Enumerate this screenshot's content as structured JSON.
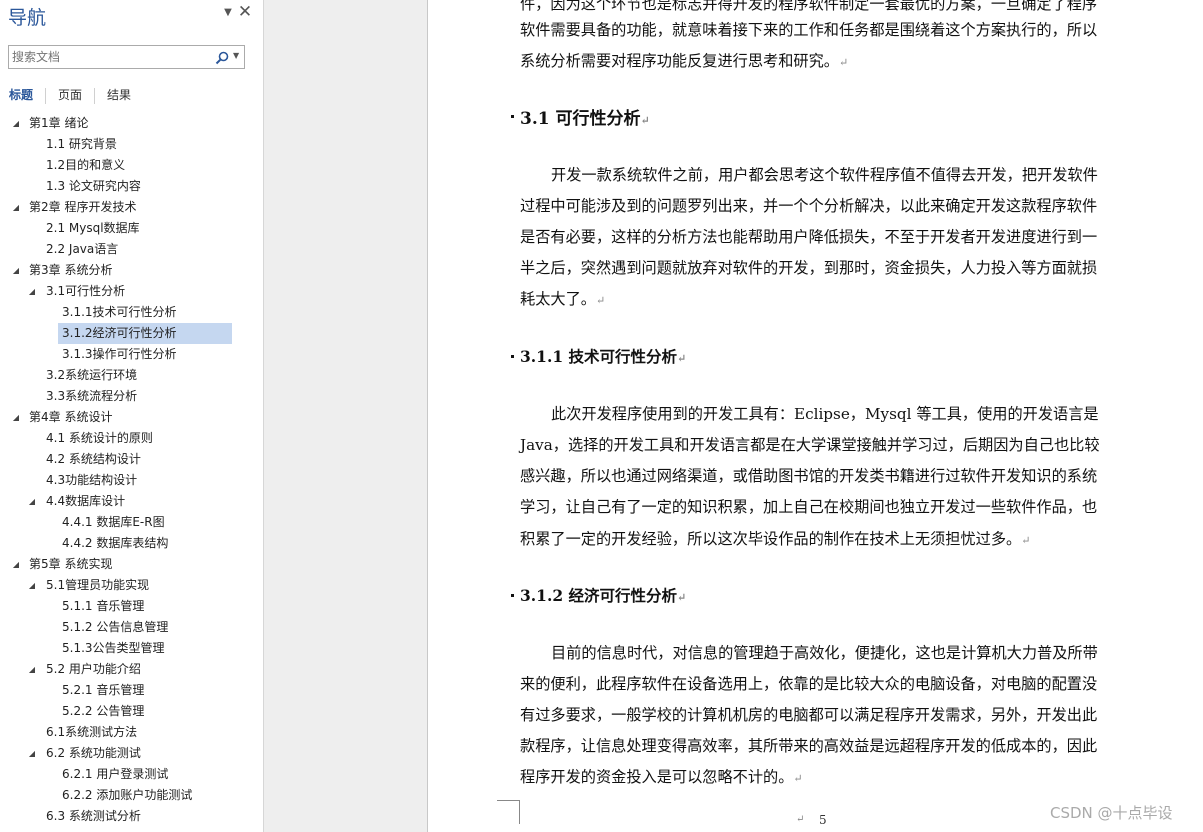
{
  "nav": {
    "title": "导航",
    "search_placeholder": "搜索文档",
    "tabs": [
      {
        "label": "标题",
        "active": true
      },
      {
        "label": "页面",
        "active": false
      },
      {
        "label": "结果",
        "active": false
      }
    ],
    "tree": [
      {
        "label": "第1章 绪论",
        "level": 0,
        "expanded": true
      },
      {
        "label": "1.1 研究背景",
        "level": 1
      },
      {
        "label": "1.2目的和意义",
        "level": 1
      },
      {
        "label": "1.3 论文研究内容",
        "level": 1
      },
      {
        "label": "第2章 程序开发技术",
        "level": 0,
        "expanded": true
      },
      {
        "label": "2.1 Mysql数据库",
        "level": 1
      },
      {
        "label": "2.2 Java语言",
        "level": 1
      },
      {
        "label": "第3章 系统分析",
        "level": 0,
        "expanded": true
      },
      {
        "label": "3.1可行性分析",
        "level": 1,
        "expanded": true
      },
      {
        "label": "3.1.1技术可行性分析",
        "level": 2
      },
      {
        "label": "3.1.2经济可行性分析",
        "level": 2,
        "selected": true
      },
      {
        "label": "3.1.3操作可行性分析",
        "level": 2
      },
      {
        "label": "3.2系统运行环境",
        "level": 1
      },
      {
        "label": "3.3系统流程分析",
        "level": 1
      },
      {
        "label": "第4章 系统设计",
        "level": 0,
        "expanded": true
      },
      {
        "label": "4.1 系统设计的原则",
        "level": 1
      },
      {
        "label": "4.2 系统结构设计",
        "level": 1
      },
      {
        "label": "4.3功能结构设计",
        "level": 1
      },
      {
        "label": "4.4数据库设计",
        "level": 1,
        "expanded": true
      },
      {
        "label": "4.4.1 数据库E-R图",
        "level": 2
      },
      {
        "label": "4.4.2 数据库表结构",
        "level": 2
      },
      {
        "label": "第5章 系统实现",
        "level": 0,
        "expanded": true
      },
      {
        "label": "5.1管理员功能实现",
        "level": 1,
        "expanded": true
      },
      {
        "label": "5.1.1 音乐管理",
        "level": 2
      },
      {
        "label": "5.1.2 公告信息管理",
        "level": 2
      },
      {
        "label": "5.1.3公告类型管理",
        "level": 2
      },
      {
        "label": "5.2 用户功能介绍",
        "level": 1,
        "expanded": true
      },
      {
        "label": "5.2.1 音乐管理",
        "level": 2
      },
      {
        "label": "5.2.2 公告管理",
        "level": 2
      },
      {
        "label": "6.1系统测试方法",
        "level": 1
      },
      {
        "label": "6.2 系统功能测试",
        "level": 1,
        "expanded": true
      },
      {
        "label": "6.2.1 用户登录测试",
        "level": 2
      },
      {
        "label": "6.2.2 添加账户功能测试",
        "level": 2
      },
      {
        "label": "6.3 系统测试分析",
        "level": 1
      }
    ]
  },
  "document": {
    "top_lines": [
      "件，因为这个环节也是标志并得开发的程序软件制定一套最优的方案，一旦确定了程序",
      "软件需要具备的功能，就意味着接下来的工作和任务都是围绕着这个方案执行的，所以",
      "系统分析需要对程序功能反复进行思考和研究。"
    ],
    "h_31": "3.1 可行性分析",
    "p_31": [
      "开发一款系统软件之前，用户都会思考这个软件程序值不值得去开发，把开发软件",
      "过程中可能涉及到的问题罗列出来，并一个个分析解决，以此来确定开发这款程序软件",
      "是否有必要，这样的分析方法也能帮助用户降低损失，不至于开发者开发进度进行到一",
      "半之后，突然遇到问题就放弃对软件的开发，到那时，资金损失，人力投入等方面就损",
      "耗太大了。"
    ],
    "h_311": "3.1.1 技术可行性分析",
    "p_311": [
      "此次开发程序使用到的开发工具有：Eclipse，Mysql 等工具，使用的开发语言是",
      "Java，选择的开发工具和开发语言都是在大学课堂接触并学习过，后期因为自己也比较",
      "感兴趣，所以也通过网络渠道，或借助图书馆的开发类书籍进行过软件开发知识的系统",
      "学习，让自己有了一定的知识积累，加上自己在校期间也独立开发过一些软件作品，也",
      "积累了一定的开发经验，所以这次毕设作品的制作在技术上无须担忧过多。"
    ],
    "h_312": "3.1.2 经济可行性分析",
    "p_312": [
      "目前的信息时代，对信息的管理趋于高效化，便捷化，这也是计算机大力普及所带",
      "来的便利，此程序软件在设备选用上，依靠的是比较大众的电脑设备，对电脑的配置没",
      "有过多要求，一般学校的计算机机房的电脑都可以满足程序开发需求，另外，开发出此",
      "款程序，让信息处理变得高效率，其所带来的高效益是远超程序开发的低成本的，因此",
      "程序开发的资金投入是可以忽略不计的。"
    ],
    "para_mark": "↵",
    "page_number": "5"
  },
  "watermark": "CSDN @十点毕设",
  "colors": {
    "accent": "#2b579a",
    "selection": "#c5d7f0"
  }
}
